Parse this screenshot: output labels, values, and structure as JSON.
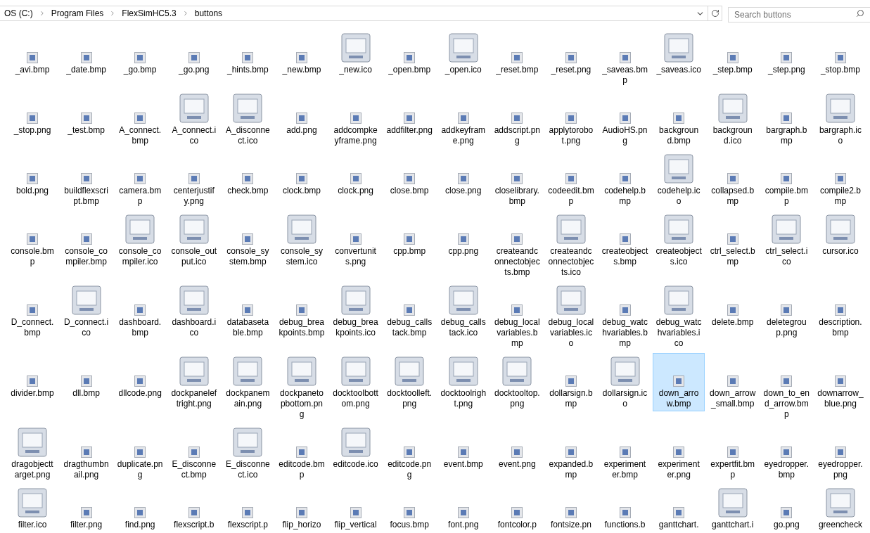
{
  "address_bar": {
    "breadcrumbs": [
      "OS (C:)",
      "Program Files",
      "FlexSimHC5.3",
      "buttons"
    ]
  },
  "search": {
    "placeholder": "Search buttons"
  },
  "files": [
    {
      "name": "_avi.bmp",
      "kind": "small",
      "selected": false
    },
    {
      "name": "_date.bmp",
      "kind": "small",
      "selected": false
    },
    {
      "name": "_go.bmp",
      "kind": "small",
      "selected": false
    },
    {
      "name": "_go.png",
      "kind": "small",
      "selected": false
    },
    {
      "name": "_hints.bmp",
      "kind": "small",
      "selected": false
    },
    {
      "name": "_new.bmp",
      "kind": "small",
      "selected": false
    },
    {
      "name": "_new.ico",
      "kind": "large",
      "selected": false
    },
    {
      "name": "_open.bmp",
      "kind": "small",
      "selected": false
    },
    {
      "name": "_open.ico",
      "kind": "large",
      "selected": false
    },
    {
      "name": "_reset.bmp",
      "kind": "small",
      "selected": false
    },
    {
      "name": "_reset.png",
      "kind": "small",
      "selected": false
    },
    {
      "name": "_saveas.bmp",
      "kind": "small",
      "selected": false
    },
    {
      "name": "_saveas.ico",
      "kind": "large",
      "selected": false
    },
    {
      "name": "_step.bmp",
      "kind": "small",
      "selected": false
    },
    {
      "name": "_step.png",
      "kind": "small",
      "selected": false
    },
    {
      "name": "_stop.bmp",
      "kind": "small",
      "selected": false
    },
    {
      "name": "_stop.png",
      "kind": "small",
      "selected": false
    },
    {
      "name": "_test.bmp",
      "kind": "small",
      "selected": false
    },
    {
      "name": "A_connect.bmp",
      "kind": "small",
      "selected": false
    },
    {
      "name": "A_connect.ico",
      "kind": "large",
      "selected": false
    },
    {
      "name": "A_disconnect.ico",
      "kind": "large",
      "selected": false
    },
    {
      "name": "add.png",
      "kind": "small",
      "selected": false
    },
    {
      "name": "addcompkeyframe.png",
      "kind": "small",
      "selected": false
    },
    {
      "name": "addfilter.png",
      "kind": "small",
      "selected": false
    },
    {
      "name": "addkeyframe.png",
      "kind": "small",
      "selected": false
    },
    {
      "name": "addscript.png",
      "kind": "small",
      "selected": false
    },
    {
      "name": "applytorobot.png",
      "kind": "small",
      "selected": false
    },
    {
      "name": "AudioHS.png",
      "kind": "small",
      "selected": false
    },
    {
      "name": "background.bmp",
      "kind": "small",
      "selected": false
    },
    {
      "name": "background.ico",
      "kind": "large",
      "selected": false
    },
    {
      "name": "bargraph.bmp",
      "kind": "small",
      "selected": false
    },
    {
      "name": "bargraph.ico",
      "kind": "large",
      "selected": false
    },
    {
      "name": "bold.png",
      "kind": "small",
      "selected": false
    },
    {
      "name": "buildflexscript.bmp",
      "kind": "small",
      "selected": false
    },
    {
      "name": "camera.bmp",
      "kind": "small",
      "selected": false
    },
    {
      "name": "centerjustify.png",
      "kind": "small",
      "selected": false
    },
    {
      "name": "check.bmp",
      "kind": "small",
      "selected": false
    },
    {
      "name": "clock.bmp",
      "kind": "small",
      "selected": false
    },
    {
      "name": "clock.png",
      "kind": "small",
      "selected": false
    },
    {
      "name": "close.bmp",
      "kind": "small",
      "selected": false
    },
    {
      "name": "close.png",
      "kind": "small",
      "selected": false
    },
    {
      "name": "closelibrary.bmp",
      "kind": "small",
      "selected": false
    },
    {
      "name": "codeedit.bmp",
      "kind": "small",
      "selected": false
    },
    {
      "name": "codehelp.bmp",
      "kind": "small",
      "selected": false
    },
    {
      "name": "codehelp.ico",
      "kind": "large",
      "selected": false
    },
    {
      "name": "collapsed.bmp",
      "kind": "small",
      "selected": false
    },
    {
      "name": "compile.bmp",
      "kind": "small",
      "selected": false
    },
    {
      "name": "compile2.bmp",
      "kind": "small",
      "selected": false
    },
    {
      "name": "console.bmp",
      "kind": "small",
      "selected": false
    },
    {
      "name": "console_compiler.bmp",
      "kind": "small",
      "selected": false
    },
    {
      "name": "console_compiler.ico",
      "kind": "large",
      "selected": false
    },
    {
      "name": "console_output.ico",
      "kind": "large",
      "selected": false
    },
    {
      "name": "console_system.bmp",
      "kind": "small",
      "selected": false
    },
    {
      "name": "console_system.ico",
      "kind": "large",
      "selected": false
    },
    {
      "name": "convertunits.png",
      "kind": "small",
      "selected": false
    },
    {
      "name": "cpp.bmp",
      "kind": "small",
      "selected": false
    },
    {
      "name": "cpp.png",
      "kind": "small",
      "selected": false
    },
    {
      "name": "createandconnectobjects.bmp",
      "kind": "small",
      "selected": false
    },
    {
      "name": "createandconnectobjects.ico",
      "kind": "large",
      "selected": false
    },
    {
      "name": "createobjects.bmp",
      "kind": "small",
      "selected": false
    },
    {
      "name": "createobjects.ico",
      "kind": "large",
      "selected": false
    },
    {
      "name": "ctrl_select.bmp",
      "kind": "small",
      "selected": false
    },
    {
      "name": "ctrl_select.ico",
      "kind": "large",
      "selected": false
    },
    {
      "name": "cursor.ico",
      "kind": "large",
      "selected": false
    },
    {
      "name": "D_connect.bmp",
      "kind": "small",
      "selected": false
    },
    {
      "name": "D_connect.ico",
      "kind": "large",
      "selected": false
    },
    {
      "name": "dashboard.bmp",
      "kind": "small",
      "selected": false
    },
    {
      "name": "dashboard.ico",
      "kind": "large",
      "selected": false
    },
    {
      "name": "databasetable.bmp",
      "kind": "small",
      "selected": false
    },
    {
      "name": "debug_breakpoints.bmp",
      "kind": "small",
      "selected": false
    },
    {
      "name": "debug_breakpoints.ico",
      "kind": "large",
      "selected": false
    },
    {
      "name": "debug_callstack.bmp",
      "kind": "small",
      "selected": false
    },
    {
      "name": "debug_callstack.ico",
      "kind": "large",
      "selected": false
    },
    {
      "name": "debug_localvariables.bmp",
      "kind": "small",
      "selected": false
    },
    {
      "name": "debug_localvariables.ico",
      "kind": "large",
      "selected": false
    },
    {
      "name": "debug_watchvariables.bmp",
      "kind": "small",
      "selected": false
    },
    {
      "name": "debug_watchvariables.ico",
      "kind": "large",
      "selected": false
    },
    {
      "name": "delete.bmp",
      "kind": "small",
      "selected": false
    },
    {
      "name": "deletegroup.png",
      "kind": "small",
      "selected": false
    },
    {
      "name": "description.bmp",
      "kind": "small",
      "selected": false
    },
    {
      "name": "divider.bmp",
      "kind": "small",
      "selected": false
    },
    {
      "name": "dll.bmp",
      "kind": "small",
      "selected": false
    },
    {
      "name": "dllcode.png",
      "kind": "small",
      "selected": false
    },
    {
      "name": "dockpaneleftright.png",
      "kind": "large",
      "selected": false
    },
    {
      "name": "dockpanemain.png",
      "kind": "large",
      "selected": false
    },
    {
      "name": "dockpanetopbottom.png",
      "kind": "large",
      "selected": false
    },
    {
      "name": "docktoolbottom.png",
      "kind": "large",
      "selected": false
    },
    {
      "name": "docktoolleft.png",
      "kind": "large",
      "selected": false
    },
    {
      "name": "docktoolright.png",
      "kind": "large",
      "selected": false
    },
    {
      "name": "docktooltop.png",
      "kind": "large",
      "selected": false
    },
    {
      "name": "dollarsign.bmp",
      "kind": "small",
      "selected": false
    },
    {
      "name": "dollarsign.ico",
      "kind": "large",
      "selected": false
    },
    {
      "name": "down_arrow.bmp",
      "kind": "small",
      "selected": true
    },
    {
      "name": "down_arrow_small.bmp",
      "kind": "small",
      "selected": false
    },
    {
      "name": "down_to_end_arrow.bmp",
      "kind": "small",
      "selected": false
    },
    {
      "name": "downarrow_blue.png",
      "kind": "small",
      "selected": false
    },
    {
      "name": "dragobjecttarget.png",
      "kind": "large",
      "selected": false
    },
    {
      "name": "dragthumbnail.png",
      "kind": "small",
      "selected": false
    },
    {
      "name": "duplicate.png",
      "kind": "small",
      "selected": false
    },
    {
      "name": "E_disconnect.bmp",
      "kind": "small",
      "selected": false
    },
    {
      "name": "E_disconnect.ico",
      "kind": "large",
      "selected": false
    },
    {
      "name": "editcode.bmp",
      "kind": "small",
      "selected": false
    },
    {
      "name": "editcode.ico",
      "kind": "large",
      "selected": false
    },
    {
      "name": "editcode.png",
      "kind": "small",
      "selected": false
    },
    {
      "name": "event.bmp",
      "kind": "small",
      "selected": false
    },
    {
      "name": "event.png",
      "kind": "small",
      "selected": false
    },
    {
      "name": "expanded.bmp",
      "kind": "small",
      "selected": false
    },
    {
      "name": "experimenter.bmp",
      "kind": "small",
      "selected": false
    },
    {
      "name": "experimenter.png",
      "kind": "small",
      "selected": false
    },
    {
      "name": "expertfit.bmp",
      "kind": "small",
      "selected": false
    },
    {
      "name": "eyedropper.bmp",
      "kind": "small",
      "selected": false
    },
    {
      "name": "eyedropper.png",
      "kind": "small",
      "selected": false
    },
    {
      "name": "filter.ico",
      "kind": "large",
      "selected": false
    },
    {
      "name": "filter.png",
      "kind": "small",
      "selected": false
    },
    {
      "name": "find.png",
      "kind": "small",
      "selected": false
    },
    {
      "name": "flexscript.b",
      "kind": "small",
      "selected": false
    },
    {
      "name": "flexscript.p",
      "kind": "small",
      "selected": false
    },
    {
      "name": "flip_horizo",
      "kind": "small",
      "selected": false
    },
    {
      "name": "flip_vertical",
      "kind": "small",
      "selected": false
    },
    {
      "name": "focus.bmp",
      "kind": "small",
      "selected": false
    },
    {
      "name": "font.png",
      "kind": "small",
      "selected": false
    },
    {
      "name": "fontcolor.p",
      "kind": "small",
      "selected": false
    },
    {
      "name": "fontsize.pn",
      "kind": "small",
      "selected": false
    },
    {
      "name": "functions.b",
      "kind": "small",
      "selected": false
    },
    {
      "name": "ganttchart.",
      "kind": "small",
      "selected": false
    },
    {
      "name": "ganttchart.i",
      "kind": "large",
      "selected": false
    },
    {
      "name": "go.png",
      "kind": "small",
      "selected": false
    },
    {
      "name": "greencheck",
      "kind": "large",
      "selected": false
    }
  ]
}
